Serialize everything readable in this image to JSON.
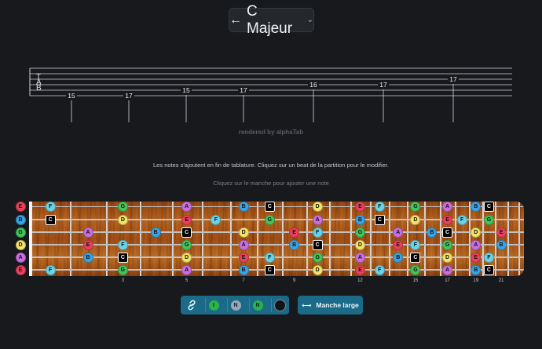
{
  "header": {
    "scale_button_label": "C Majeur",
    "back_arrow": "←",
    "chevron": "⌄"
  },
  "tab": {
    "clef_letters": [
      "T",
      "A",
      "B"
    ],
    "notes": [
      {
        "fret": "15",
        "string": 5
      },
      {
        "fret": "17",
        "string": 5
      },
      {
        "fret": "15",
        "string": 4
      },
      {
        "fret": "17",
        "string": 4
      },
      {
        "fret": "16",
        "string": 3
      },
      {
        "fret": "17",
        "string": 3
      },
      {
        "fret": "17",
        "string": 2
      }
    ],
    "rendered_by": "rendered by alphaTab"
  },
  "instructions": {
    "append_info": "Les notes s'ajoutent en fin de tablature. Cliquez sur un beat de la partition pour le modifier.",
    "neck_hint": "Cliquez sur le manche pour ajouter une note"
  },
  "fretboard": {
    "fret_markers": [
      "3",
      "5",
      "7",
      "9",
      "12",
      "15",
      "17",
      "19",
      "21"
    ],
    "colors": {
      "C": "#000000",
      "D": "#f2e36a",
      "E": "#e8415b",
      "F": "#67d4ea",
      "G": "#44c45c",
      "A": "#c96fe0",
      "B": "#3aa3e6"
    },
    "strings": [
      {
        "open": "E",
        "notes": [
          {
            "fret": 1,
            "n": "F"
          },
          {
            "fret": 3,
            "n": "G"
          },
          {
            "fret": 5,
            "n": "A"
          },
          {
            "fret": 7,
            "n": "B"
          },
          {
            "fret": 8,
            "n": "C"
          },
          {
            "fret": 10,
            "n": "D"
          },
          {
            "fret": 12,
            "n": "E"
          },
          {
            "fret": 13,
            "n": "F"
          },
          {
            "fret": 15,
            "n": "G"
          },
          {
            "fret": 17,
            "n": "A"
          },
          {
            "fret": 19,
            "n": "B"
          },
          {
            "fret": 20,
            "n": "C"
          }
        ]
      },
      {
        "open": "B",
        "notes": [
          {
            "fret": 1,
            "n": "C"
          },
          {
            "fret": 3,
            "n": "D"
          },
          {
            "fret": 5,
            "n": "E"
          },
          {
            "fret": 6,
            "n": "F"
          },
          {
            "fret": 8,
            "n": "G"
          },
          {
            "fret": 10,
            "n": "A"
          },
          {
            "fret": 12,
            "n": "B"
          },
          {
            "fret": 13,
            "n": "C"
          },
          {
            "fret": 15,
            "n": "D"
          },
          {
            "fret": 17,
            "n": "E"
          },
          {
            "fret": 18,
            "n": "F"
          },
          {
            "fret": 20,
            "n": "G"
          }
        ]
      },
      {
        "open": "G",
        "notes": [
          {
            "fret": 2,
            "n": "A"
          },
          {
            "fret": 4,
            "n": "B"
          },
          {
            "fret": 5,
            "n": "C"
          },
          {
            "fret": 7,
            "n": "D"
          },
          {
            "fret": 9,
            "n": "E"
          },
          {
            "fret": 10,
            "n": "F"
          },
          {
            "fret": 12,
            "n": "G"
          },
          {
            "fret": 14,
            "n": "A"
          },
          {
            "fret": 16,
            "n": "B"
          },
          {
            "fret": 17,
            "n": "C"
          },
          {
            "fret": 19,
            "n": "D"
          },
          {
            "fret": 21,
            "n": "E"
          }
        ]
      },
      {
        "open": "D",
        "notes": [
          {
            "fret": 2,
            "n": "E"
          },
          {
            "fret": 3,
            "n": "F"
          },
          {
            "fret": 5,
            "n": "G"
          },
          {
            "fret": 7,
            "n": "A"
          },
          {
            "fret": 9,
            "n": "B"
          },
          {
            "fret": 10,
            "n": "C"
          },
          {
            "fret": 12,
            "n": "D"
          },
          {
            "fret": 14,
            "n": "E"
          },
          {
            "fret": 15,
            "n": "F"
          },
          {
            "fret": 17,
            "n": "G"
          },
          {
            "fret": 19,
            "n": "A"
          },
          {
            "fret": 21,
            "n": "B"
          }
        ]
      },
      {
        "open": "A",
        "notes": [
          {
            "fret": 2,
            "n": "B"
          },
          {
            "fret": 3,
            "n": "C"
          },
          {
            "fret": 5,
            "n": "D"
          },
          {
            "fret": 7,
            "n": "E"
          },
          {
            "fret": 8,
            "n": "F"
          },
          {
            "fret": 10,
            "n": "G"
          },
          {
            "fret": 12,
            "n": "A"
          },
          {
            "fret": 14,
            "n": "B"
          },
          {
            "fret": 15,
            "n": "C"
          },
          {
            "fret": 17,
            "n": "D"
          },
          {
            "fret": 19,
            "n": "E"
          },
          {
            "fret": 20,
            "n": "F"
          }
        ]
      },
      {
        "open": "E",
        "notes": [
          {
            "fret": 1,
            "n": "F"
          },
          {
            "fret": 3,
            "n": "G"
          },
          {
            "fret": 5,
            "n": "A"
          },
          {
            "fret": 7,
            "n": "B"
          },
          {
            "fret": 8,
            "n": "C"
          },
          {
            "fret": 10,
            "n": "D"
          },
          {
            "fret": 12,
            "n": "E"
          },
          {
            "fret": 13,
            "n": "F"
          },
          {
            "fret": 15,
            "n": "G"
          },
          {
            "fret": 17,
            "n": "A"
          },
          {
            "fret": 19,
            "n": "B"
          },
          {
            "fret": 20,
            "n": "C"
          }
        ]
      }
    ]
  },
  "toolbar": {
    "link_icon": "link-icon",
    "toggles": [
      {
        "label": "I",
        "color": "#2bb34a"
      },
      {
        "label": "N",
        "color": "#9aa7b4"
      },
      {
        "label": "N",
        "color": "#2bb34a"
      },
      {
        "label": "",
        "color": "#111418"
      }
    ],
    "wide_neck_label": "Manche large",
    "wide_neck_icon": "⟷"
  }
}
